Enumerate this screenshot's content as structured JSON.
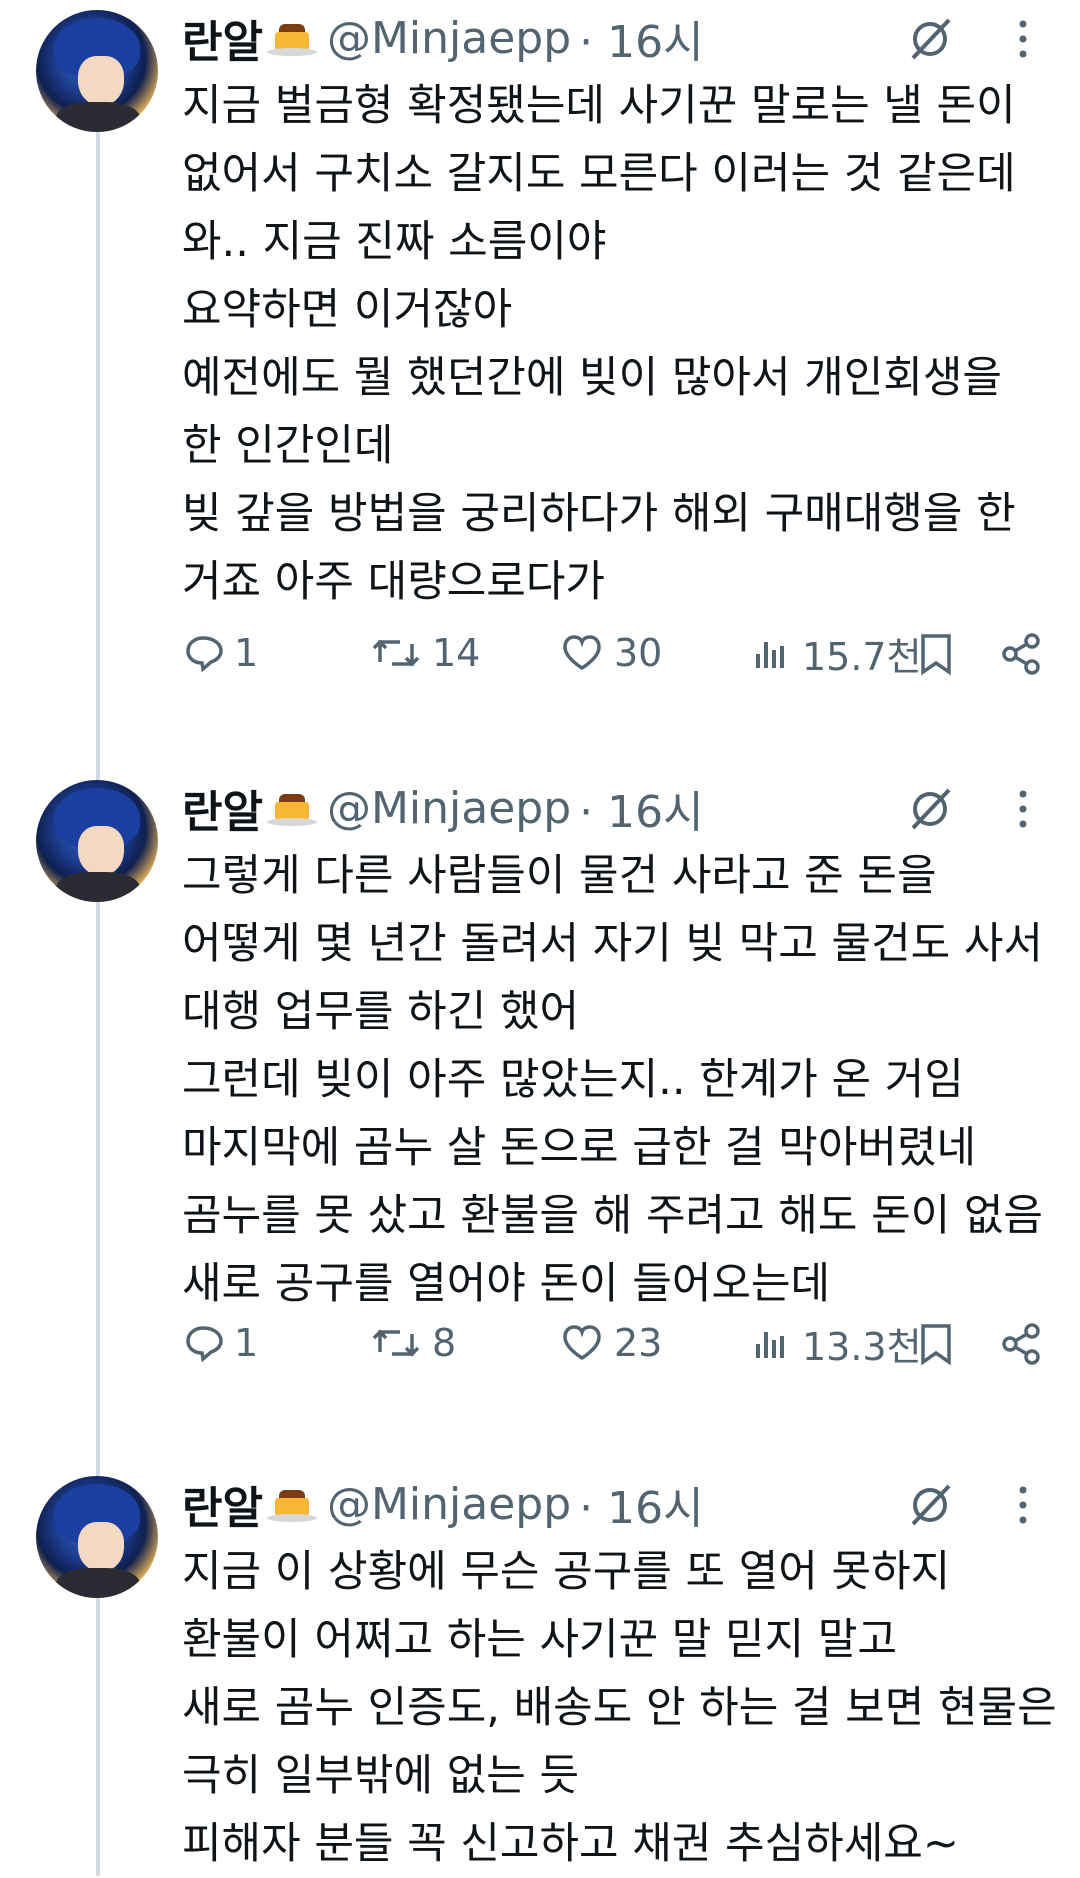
{
  "tweets": [
    {
      "display_name": "란알",
      "handle": "@Minjaepp",
      "time": "· 16시",
      "lines": [
        "지금 벌금형 확정됐는데 사기꾼 말로는 낼 돈이",
        "없어서 구치소 갈지도 모른다 이러는 것 같은데",
        "와.. 지금 진짜 소름이야",
        "요약하면 이거잖아",
        "예전에도 뭘 했던간에 빚이 많아서 개인회생을",
        "한 인간인데",
        "빚 갚을 방법을 궁리하다가 해외 구매대행을 한",
        "거죠 아주 대량으로다가"
      ],
      "replies": "1",
      "retweets": "14",
      "likes": "30",
      "views": "15.7천"
    },
    {
      "display_name": "란알",
      "handle": "@Minjaepp",
      "time": "· 16시",
      "lines": [
        "그렇게 다른 사람들이 물건 사라고 준 돈을",
        "어떻게 몇 년간 돌려서 자기 빚 막고 물건도 사서",
        "대행 업무를 하긴 했어",
        "그런데 빚이 아주 많았는지.. 한계가 온 거임",
        "마지막에 곰누 살 돈으로 급한 걸 막아버렸네",
        "곰누를 못 샀고 환불을 해 주려고 해도 돈이 없음",
        "새로 공구를 열어야 돈이 들어오는데"
      ],
      "replies": "1",
      "retweets": "8",
      "likes": "23",
      "views": "13.3천"
    },
    {
      "display_name": "란알",
      "handle": "@Minjaepp",
      "time": "· 16시",
      "lines": [
        "지금 이 상황에 무슨 공구를 또 열어 못하지",
        "환불이 어쩌고 하는 사기꾼 말 믿지 말고",
        "새로 곰누 인증도, 배송도 안 하는 걸 보면 현물은",
        "극히 일부밖에 없는 듯",
        "피해자 분들 꼭 신고하고 채권 추심하세요~"
      ]
    }
  ],
  "icons": {
    "reply": "reply-icon",
    "retweet": "retweet-icon",
    "like": "heart-icon",
    "views": "views-icon",
    "bookmark": "bookmark-icon",
    "share": "share-icon",
    "grok": "grok-icon",
    "more": "more-icon"
  },
  "colors": {
    "text": "#0f1419",
    "secondary": "#536471",
    "thread_line": "#cfd9de"
  }
}
